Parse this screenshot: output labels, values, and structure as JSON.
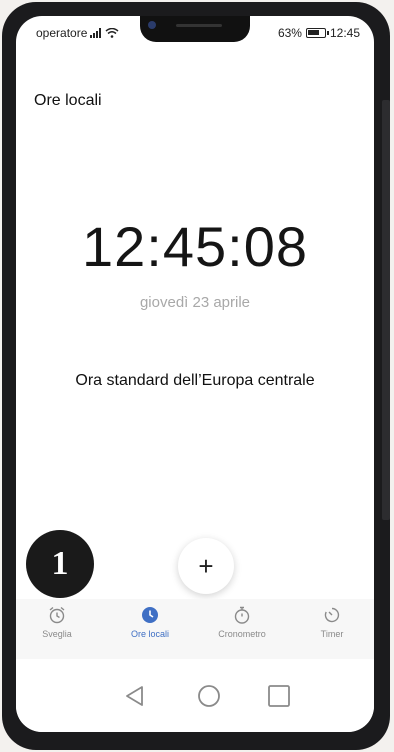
{
  "status_bar": {
    "carrier": "operatore",
    "battery": "63%",
    "time": "12:45"
  },
  "header": {
    "title": "Ore locali"
  },
  "clock": {
    "time": "12:45:08",
    "date": "giovedì 23 aprile",
    "timezone": "Ora standard dell’Europa centrale"
  },
  "fab": {
    "icon": "plus-icon",
    "label": "+"
  },
  "badge": {
    "label": "1"
  },
  "tabs": [
    {
      "label": "Sveglia",
      "icon": "alarm-clock-icon",
      "active": false
    },
    {
      "label": "Ore locali",
      "icon": "world-clock-icon",
      "active": true
    },
    {
      "label": "Cronometro",
      "icon": "stopwatch-icon",
      "active": false
    },
    {
      "label": "Timer",
      "icon": "timer-icon",
      "active": false
    }
  ],
  "nav": [
    "back-icon",
    "home-icon",
    "recents-icon"
  ],
  "colors": {
    "accent": "#3f6fc4",
    "text": "#151515",
    "muted": "#a8a8a8"
  }
}
